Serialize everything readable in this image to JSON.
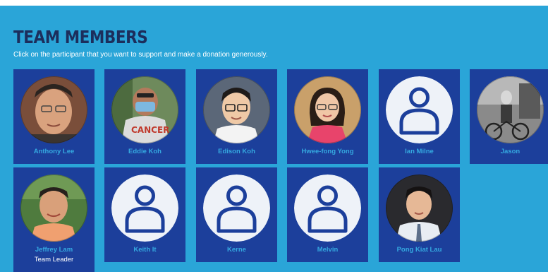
{
  "header": {
    "title": "TEAM MEMBERS",
    "subtitle": "Click on the participant that you want to support and make a donation generously."
  },
  "colors": {
    "background": "#2aa5d8",
    "card": "#1c3f9b",
    "name": "#35a9e0",
    "title": "#1c2e5c"
  },
  "members": [
    {
      "name": "Anthony Lee",
      "role": "",
      "avatar": "photo"
    },
    {
      "name": "Eddie Koh",
      "role": "",
      "avatar": "photo"
    },
    {
      "name": "Edison Koh",
      "role": "",
      "avatar": "photo"
    },
    {
      "name": "Hwee-fong Yong",
      "role": "",
      "avatar": "photo"
    },
    {
      "name": "Ian Milne",
      "role": "",
      "avatar": "default-user-icon"
    },
    {
      "name": "Jason",
      "role": "",
      "avatar": "photo"
    },
    {
      "name": "Jeffrey Lam",
      "role": "Team Leader",
      "avatar": "photo"
    },
    {
      "name": "Keith It",
      "role": "",
      "avatar": "default-user-icon"
    },
    {
      "name": "Kerne",
      "role": "",
      "avatar": "default-user-icon"
    },
    {
      "name": "Melvin",
      "role": "",
      "avatar": "default-user-icon"
    },
    {
      "name": "Pong Kiat Lau",
      "role": "",
      "avatar": "photo"
    }
  ]
}
